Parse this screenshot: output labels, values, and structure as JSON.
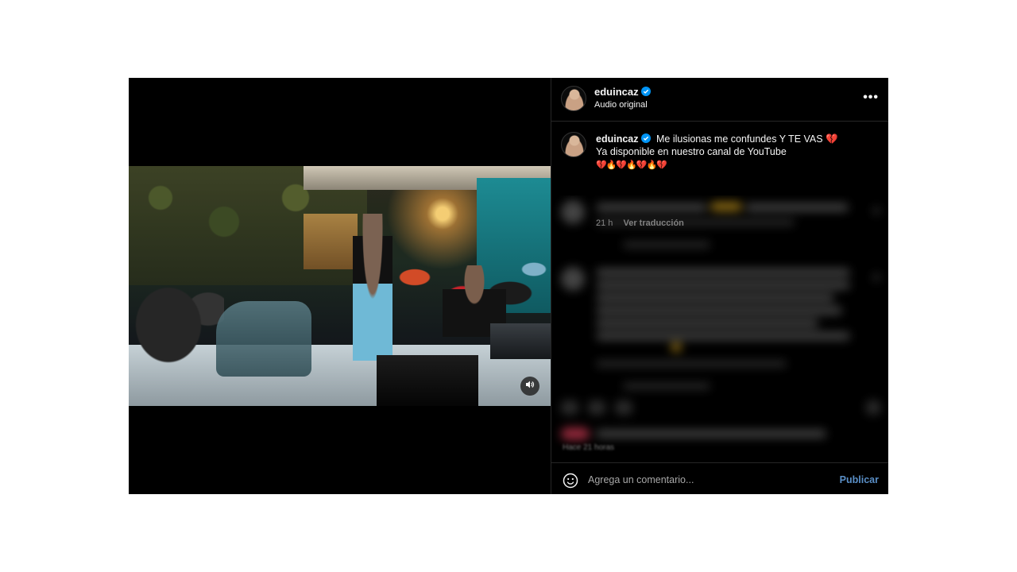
{
  "post": {
    "header": {
      "username": "eduincaz",
      "verified": true,
      "audio_label": "Audio original",
      "more_icon": "more-horizontal-icon"
    },
    "caption": {
      "username": "eduincaz",
      "line1": "Me ilusionas me confundes Y TE VAS 💔",
      "line2": "Ya disponible en nuestro canal de YouTube",
      "line3": "💔🔥💔🔥💔🔥💔",
      "time": "21 h",
      "translate_label": "Ver traducción"
    },
    "posted_ago": "Hace 21 horas",
    "comment": {
      "placeholder": "Agrega un comentario...",
      "publish_label": "Publicar",
      "emoji_icon": "smiley-icon"
    },
    "media": {
      "audio_icon": "speaker-icon"
    }
  },
  "colors": {
    "background": "#000000",
    "text": "#f5f5f5",
    "secondary_text": "#a8a8a8",
    "verified": "#0095f6",
    "publish": "#5a8fc7",
    "divider": "#262626"
  }
}
